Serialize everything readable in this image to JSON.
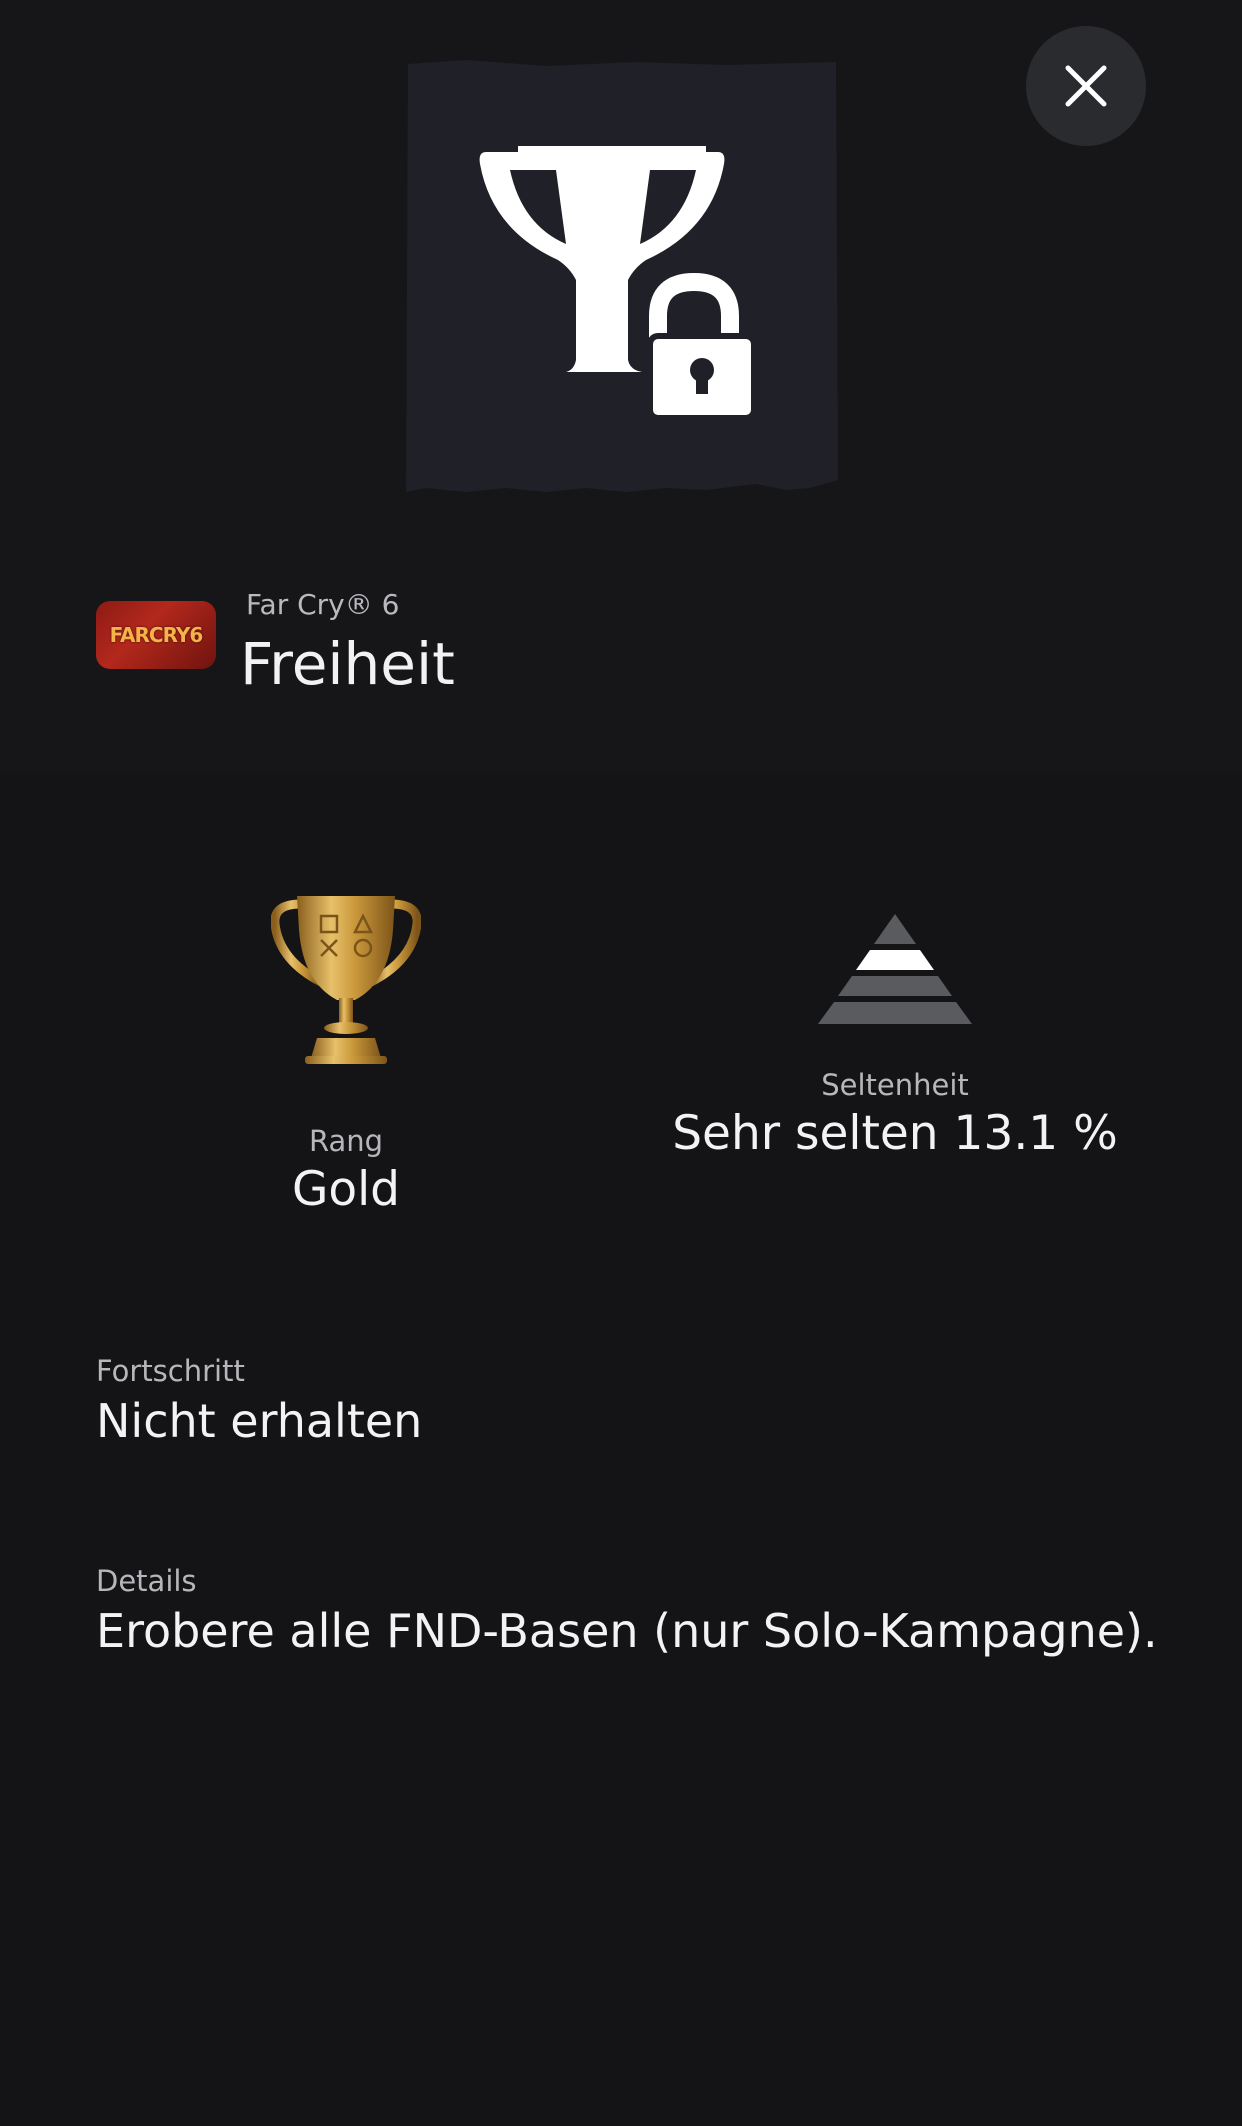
{
  "header": {
    "game_name": "Far Cry® 6",
    "trophy_title": "Freiheit",
    "game_logo_text": "FARCRY6",
    "close_icon": "close-icon",
    "trophy_icon": "locked-trophy-icon"
  },
  "stats": {
    "rank_label": "Rang",
    "rank_value": "Gold",
    "rank_icon": "gold-trophy-icon",
    "rarity_label": "Seltenheit",
    "rarity_value": "Sehr selten 13.1 %",
    "rarity_icon": "rarity-pyramid-icon",
    "rarity_percent": 13.1
  },
  "progress": {
    "label": "Fortschritt",
    "value": "Nicht erhalten"
  },
  "details": {
    "label": "Details",
    "value": "Erobere alle FND-Basen (nur Solo-Kampagne)."
  },
  "colors": {
    "background": "#141416",
    "header_background": "#161619",
    "art_background": "#1f2028",
    "gold": "#c9973a"
  }
}
